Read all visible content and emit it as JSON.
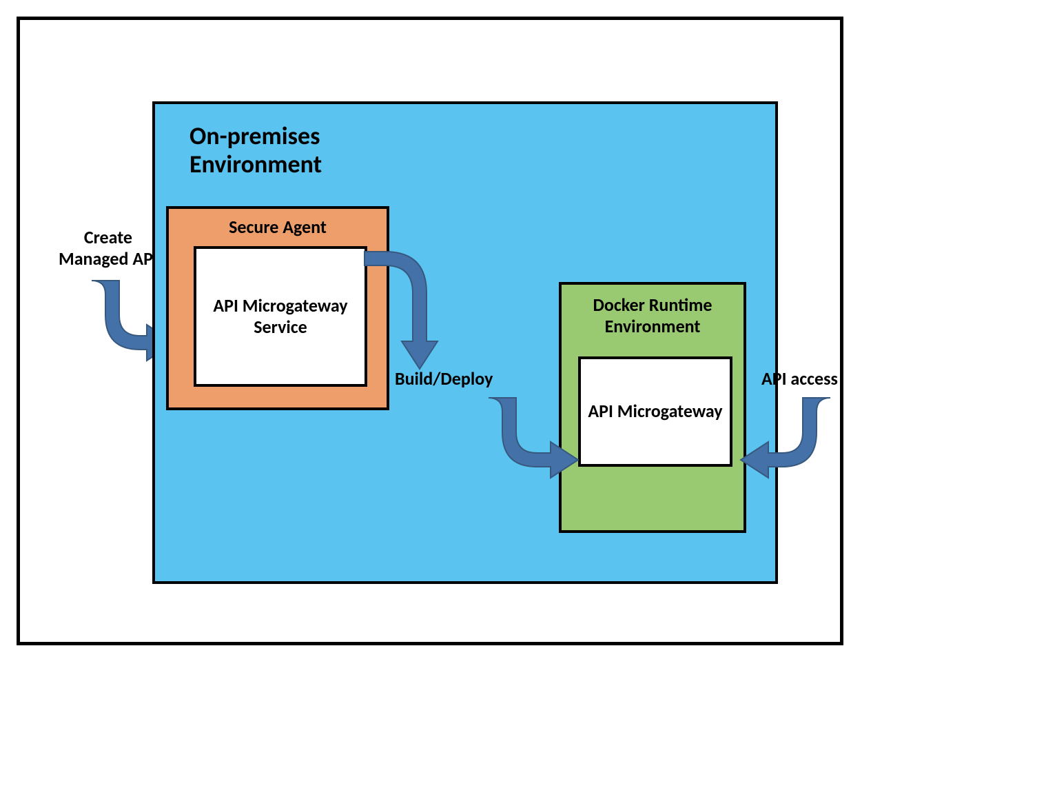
{
  "diagram": {
    "onprem_title": "On-premises\nEnvironment",
    "secure_agent_title": "Secure Agent",
    "api_mg_service": "API Microgateway Service",
    "docker_title": "Docker Runtime Environment",
    "api_mg": "API Microgateway",
    "label_create": "Create\nManaged API",
    "label_build": "Build/Deploy",
    "label_api_access": "API access"
  },
  "colors": {
    "onprem_bg": "#5ac3ef",
    "secure_agent_bg": "#ed9e6a",
    "docker_bg": "#99c971",
    "arrow_fill": "#4472a8",
    "arrow_stroke": "#37597f"
  }
}
